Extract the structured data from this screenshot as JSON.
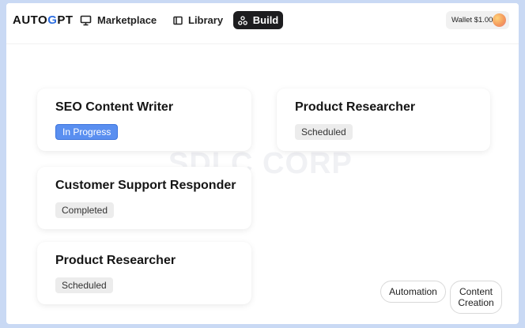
{
  "header": {
    "logo": {
      "part1": "AUTO",
      "part2": "G",
      "part3": "PT"
    },
    "nav": [
      {
        "label": "Marketplace",
        "icon": "monitor-icon"
      },
      {
        "label": "Library",
        "icon": "library-icon"
      },
      {
        "label": "Build",
        "icon": "nodes-icon",
        "active": true
      }
    ],
    "wallet_label": "Wallet $1.00"
  },
  "watermark": "SDLC CORP",
  "cards": [
    {
      "title": "SEO Content Writer",
      "status": "In Progress"
    },
    {
      "title": "Product Researcher",
      "status": "Scheduled"
    },
    {
      "title": "Customer Support Responder",
      "status": "Completed"
    },
    {
      "title": "Product Researcher",
      "status": "Scheduled"
    }
  ],
  "tags": [
    "Automation",
    "Content Creation"
  ],
  "colors": {
    "active_nav": "#1d1d1f",
    "in_progress": "#5a8ff0",
    "frame_bg": "#c9d9f4"
  }
}
